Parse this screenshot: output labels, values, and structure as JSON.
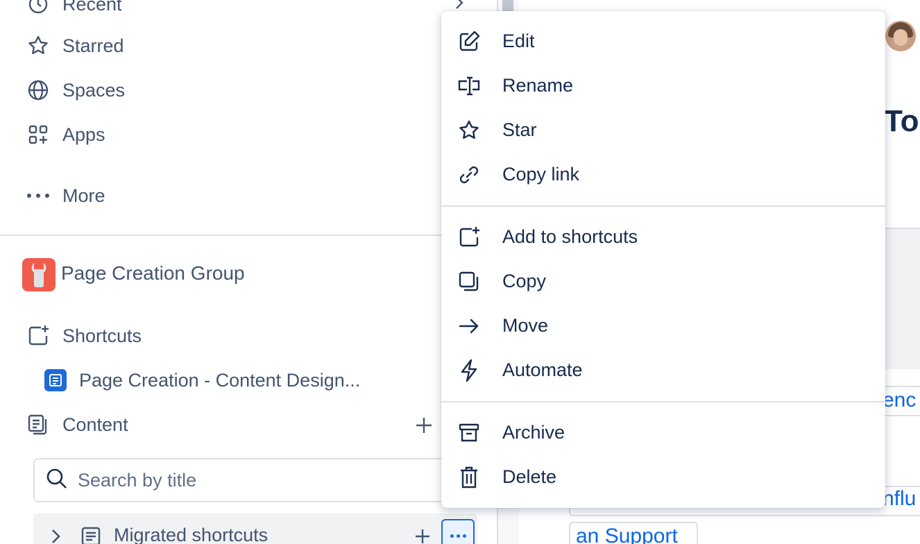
{
  "sidebar": {
    "nav": [
      {
        "label": "Recent",
        "icon": "clock-icon"
      },
      {
        "label": "Starred",
        "icon": "star-icon"
      },
      {
        "label": "Spaces",
        "icon": "globe-icon"
      },
      {
        "label": "Apps",
        "icon": "apps-icon"
      },
      {
        "label": "More",
        "icon": "more-dots-icon"
      }
    ],
    "space_name": "Page Creation Group",
    "shortcuts_label": "Shortcuts",
    "shortcut_page": "Page Creation - Content Design...",
    "content_label": "Content",
    "search_placeholder": "Search by title",
    "tree_item": "Migrated shortcuts"
  },
  "main": {
    "title_fragment": "To",
    "link1_fragment": "enc",
    "link2_fragment": "nflu",
    "link3_fragment": "an Support"
  },
  "context_menu": {
    "groups": [
      [
        {
          "label": "Edit",
          "icon": "edit-icon"
        },
        {
          "label": "Rename",
          "icon": "rename-icon"
        },
        {
          "label": "Star",
          "icon": "star-icon"
        },
        {
          "label": "Copy link",
          "icon": "link-icon"
        }
      ],
      [
        {
          "label": "Add to shortcuts",
          "icon": "add-shortcut-icon"
        },
        {
          "label": "Copy",
          "icon": "copy-icon"
        },
        {
          "label": "Move",
          "icon": "arrow-right-icon"
        },
        {
          "label": "Automate",
          "icon": "lightning-icon"
        }
      ],
      [
        {
          "label": "Archive",
          "icon": "archive-icon"
        },
        {
          "label": "Delete",
          "icon": "trash-icon"
        }
      ]
    ]
  },
  "colors": {
    "text_subtle": "#44546f",
    "text": "#172b4d",
    "brand_blue": "#1d6ad8",
    "link_blue": "#0c66e4",
    "space_logo": "#f15b4b",
    "border": "#dcdfe4"
  }
}
